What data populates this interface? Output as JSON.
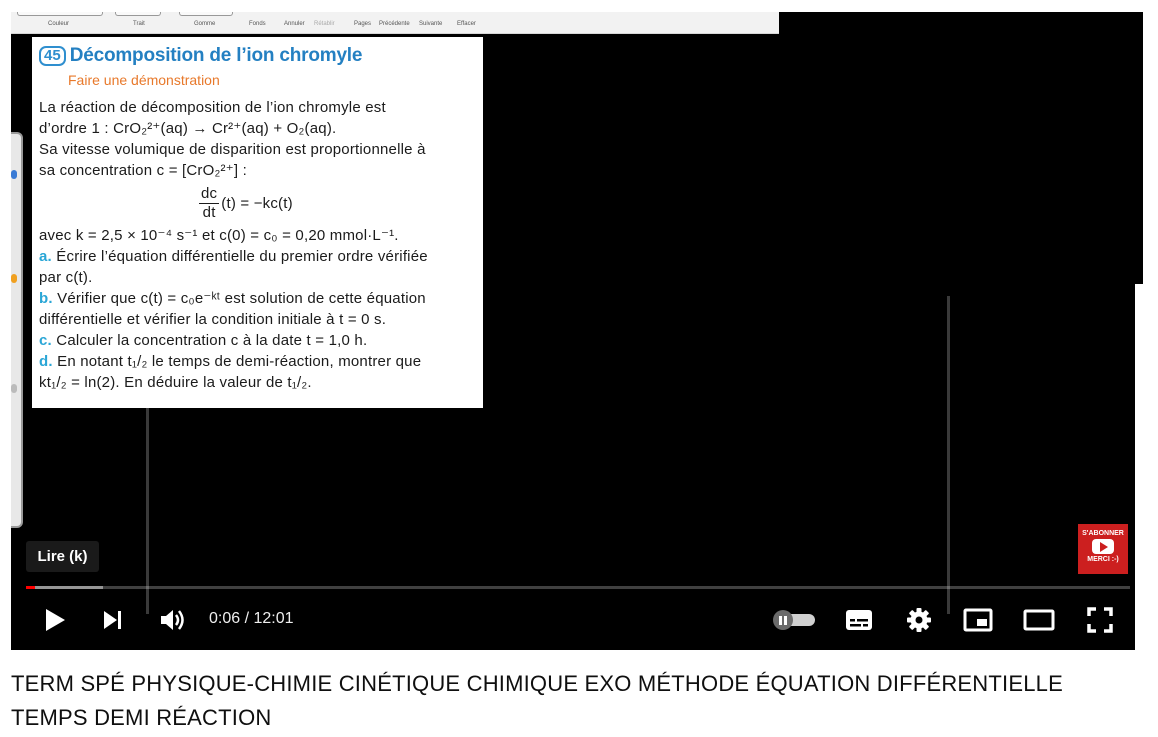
{
  "toolbar": {
    "tools": [
      "Couleur",
      "Trait",
      "Gomme",
      "Fonds",
      "Annuler",
      "Rétablir",
      "Pages",
      "Précédente",
      "Suivante",
      "Effacer"
    ]
  },
  "exercise": {
    "number": "45",
    "title": "Décomposition de l’ion chromyle",
    "subtitle": "Faire une démonstration",
    "line1": "La réaction de décomposition de l’ion chromyle est",
    "line2": "d’ordre 1 : CrO₂²⁺(aq) → Cr²⁺(aq) + O₂(aq).",
    "line3": "Sa vitesse volumique de disparition est proportionnelle à",
    "line4": "sa concentration c = [CrO₂²⁺] :",
    "formula_num": "dc",
    "formula_den": "dt",
    "formula_rhs": "(t) = −kc(t)",
    "line5": "avec k = 2,5 × 10⁻⁴ s⁻¹ et c(0) = c₀ = 0,20 mmol·L⁻¹.",
    "qa_label": "a.",
    "qa_1": "Écrire l’équation différentielle du premier ordre vérifiée",
    "qa_2": "par c(t).",
    "qb_label": "b.",
    "qb_1": "Vérifier que c(t) = c₀e⁻ᵏᵗ est solution de cette équation",
    "qb_2": "différentielle et vérifier la condition initiale à t = 0 s.",
    "qc_label": "c.",
    "qc_1": "Calculer la concentration c à la date t = 1,0 h.",
    "qd_label": "d.",
    "qd_1": "En notant t₁/₂ le temps de demi-réaction, montrer que",
    "qd_2": "kt₁/₂ = ln(2). En déduire la valeur de t₁/₂."
  },
  "subscribe": {
    "line1": "S'ABONNER",
    "line2": "MERCI :-)"
  },
  "tooltip": "Lire (k)",
  "player": {
    "current_time": "0:06",
    "separator": " / ",
    "duration": "12:01",
    "played_fraction": 0.0083,
    "loaded_fraction": 0.07
  },
  "icons": {
    "play": "play-icon",
    "next": "next-icon",
    "volume": "volume-icon",
    "autoplay": "autoplay-toggle",
    "subtitles": "subtitles-icon",
    "settings": "gear-icon",
    "miniplayer": "miniplayer-icon",
    "theater": "theater-icon",
    "fullscreen": "fullscreen-icon"
  },
  "colors": {
    "accent_red": "#ff0000",
    "title_blue": "#2480c2",
    "subtitle_orange": "#e8792b",
    "question_blue": "#2aa6d6"
  },
  "video_title": {
    "line1": "TERM SPÉ PHYSIQUE-CHIMIE CINÉTIQUE CHIMIQUE EXO MÉTHODE ÉQUATION DIFFÉRENTIELLE",
    "line2": "TEMPS DEMI RÉACTION"
  }
}
